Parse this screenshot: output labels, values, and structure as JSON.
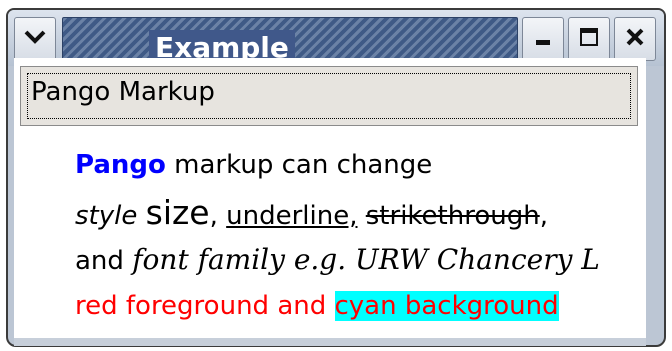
{
  "window": {
    "title": "Example",
    "menu_icon": "chevron-down-icon",
    "minimize_icon": "minimize-icon",
    "maximize_icon": "maximize-icon",
    "close_icon": "close-icon"
  },
  "section": {
    "label": "Pango Markup"
  },
  "markup": {
    "line1": {
      "word_pango": "Pango",
      "rest": " markup can change"
    },
    "line2": {
      "style": "style",
      "size": "size",
      "comma1": ", ",
      "underline": "underline,",
      "space": " ",
      "strike": "strikethrough",
      "comma2": ","
    },
    "line3": {
      "and": "and ",
      "font_family": "font family e.g. URW Chancery L"
    },
    "line4": {
      "red_text": "red foreground and ",
      "cyan_text": "cyan background"
    }
  },
  "colors": {
    "pango": "#0000ff",
    "red": "#ff0000",
    "cyan": "#00ffff"
  }
}
